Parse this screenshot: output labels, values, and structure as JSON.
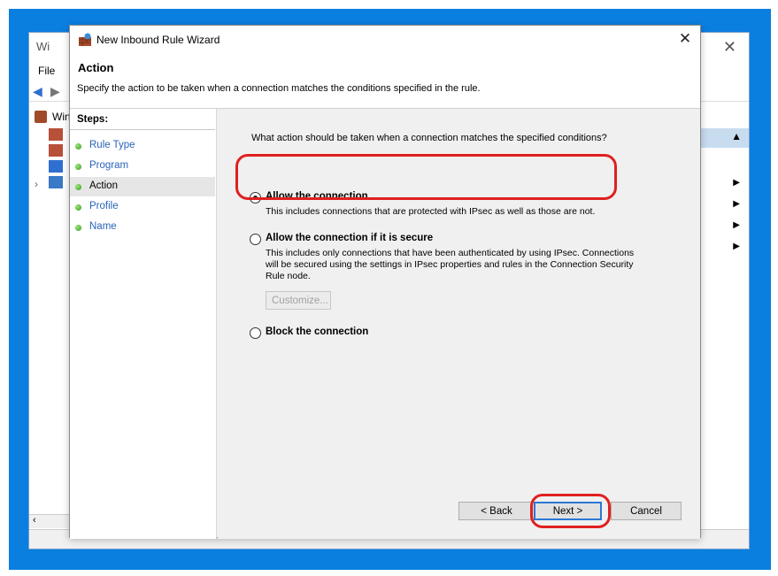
{
  "background_window": {
    "title_fragment": "Wi",
    "menu_file": "File",
    "tree_label_fragment": "Win"
  },
  "dialog": {
    "title": "New Inbound Rule Wizard",
    "close_glyph": "✕",
    "header_title": "Action",
    "header_desc": "Specify the action to be taken when a connection matches the conditions specified in the rule."
  },
  "steps": {
    "title": "Steps:",
    "items": [
      {
        "label": "Rule Type"
      },
      {
        "label": "Program"
      },
      {
        "label": "Action"
      },
      {
        "label": "Profile"
      },
      {
        "label": "Name"
      }
    ],
    "active_index": 2
  },
  "content": {
    "question": "What action should be taken when a connection matches the specified conditions?",
    "options": [
      {
        "label": "Allow the connection",
        "desc": "This includes connections that are protected with IPsec as well as those are not.",
        "selected": true
      },
      {
        "label": "Allow the connection if it is secure",
        "desc": "This includes only connections that have been authenticated by using IPsec.  Connections will be secured using the settings in IPsec properties and rules in the Connection Security Rule node.",
        "selected": false
      },
      {
        "label": "Block the connection",
        "desc": "",
        "selected": false
      }
    ],
    "customize_label": "Customize..."
  },
  "buttons": {
    "back": "< Back",
    "next": "Next >",
    "cancel": "Cancel"
  },
  "colors": {
    "highlight": "#e02020",
    "desktop": "#0a7fe0",
    "link": "#2a62b8"
  }
}
